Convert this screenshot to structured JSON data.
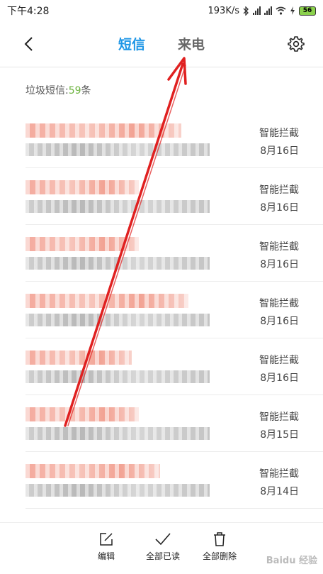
{
  "status_bar": {
    "time": "下午4:28",
    "speed": "193K/s",
    "battery": "56"
  },
  "header": {
    "tab_sms": "短信",
    "tab_calls": "来电",
    "active_color": "#1e96e6"
  },
  "spam": {
    "label": "垃圾短信:",
    "count": "59",
    "unit": "条"
  },
  "messages": [
    {
      "tag": "智能拦截",
      "date": "8月16日"
    },
    {
      "tag": "智能拦截",
      "date": "8月16日"
    },
    {
      "tag": "智能拦截",
      "date": "8月16日"
    },
    {
      "tag": "智能拦截",
      "date": "8月16日"
    },
    {
      "tag": "智能拦截",
      "date": "8月16日"
    },
    {
      "tag": "智能拦截",
      "date": "8月15日"
    },
    {
      "tag": "智能拦截",
      "date": "8月14日"
    }
  ],
  "toolbar": {
    "edit": "编辑",
    "read_all": "全部已读",
    "delete_all": "全部删除"
  },
  "watermark": "Baidu 经验",
  "annotation_color": "#e02020"
}
